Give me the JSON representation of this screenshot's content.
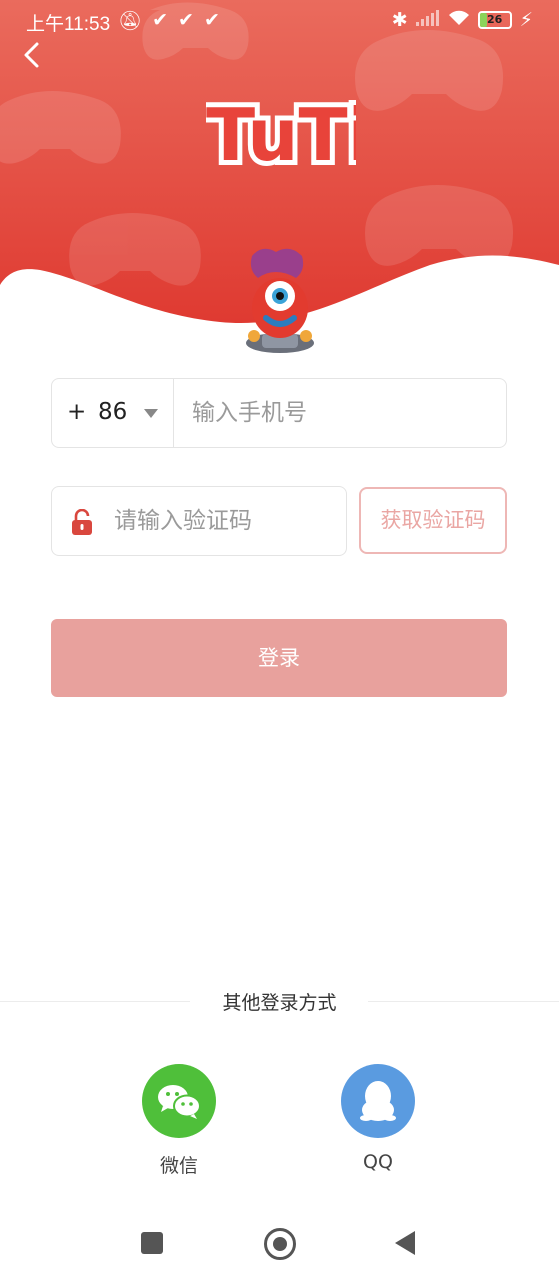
{
  "status_bar": {
    "time": "上午11:53",
    "battery": "26",
    "battery_level": 0.26,
    "accent": "#ffffff"
  },
  "header": {
    "logo_text": "TuTi",
    "back_icon": "chevron-left-icon",
    "colors": {
      "top": "#e9695a",
      "bottom": "#e03d33"
    }
  },
  "form": {
    "country_plus": "+",
    "country_code": "86",
    "phone_placeholder": "输入手机号",
    "code_placeholder": "请输入验证码",
    "get_code_label": "获取验证码",
    "login_label": "登录",
    "colors": {
      "login_bg": "#e8a19d",
      "get_code_text": "#eaa6a3",
      "lock": "#d9473e"
    }
  },
  "other_login": {
    "title": "其他登录方式",
    "options": [
      {
        "label": "微信",
        "icon": "wechat-icon",
        "color": "#4fbf3a"
      },
      {
        "label": "QQ",
        "icon": "qq-icon",
        "color": "#5a9be0"
      }
    ]
  },
  "nav_bar": {
    "icons": [
      "recent-apps-icon",
      "home-icon",
      "back-icon"
    ]
  }
}
